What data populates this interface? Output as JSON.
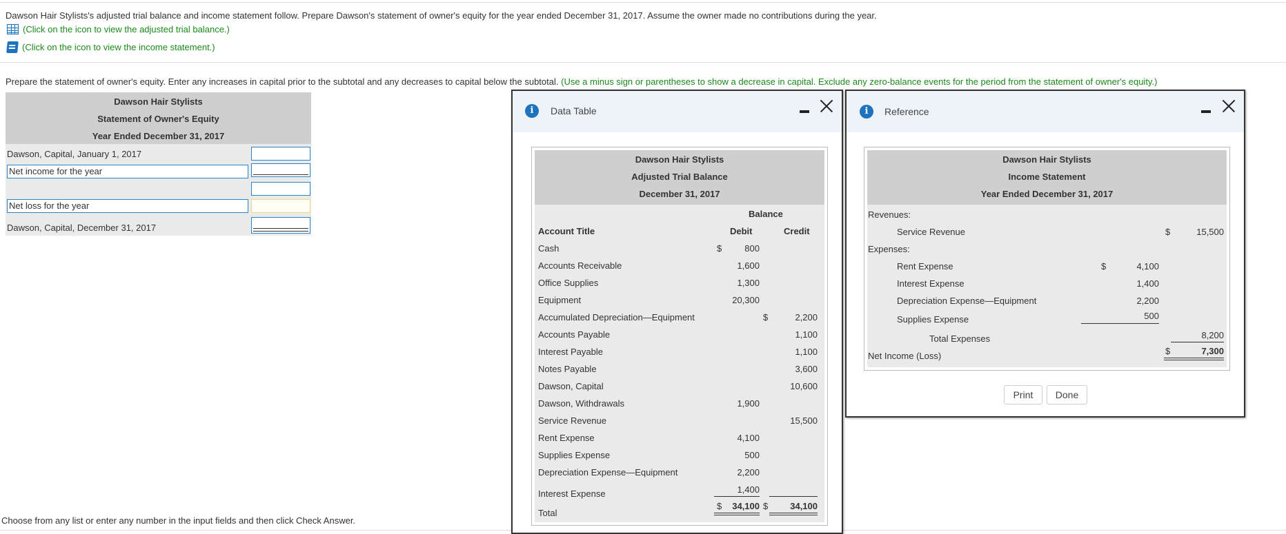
{
  "problem": {
    "prompt": "Dawson Hair Stylists's adjusted trial balance and income statement follow. Prepare Dawson's statement of owner's equity for the year ended December 31, 2017. Assume the owner made no contributions during the year.",
    "link1": "(Click on the icon to view the adjusted trial balance.)",
    "link2": "(Click on the icon to view the income statement.)",
    "instruction": "Prepare the statement of owner's equity. Enter any increases in capital prior to the subtotal and any decreases to capital below the subtotal.",
    "instruction_hint": "(Use a minus sign or parentheses to show a decrease in capital. Exclude any zero-balance events for the period from the statement of owner's equity.)",
    "footer": "Choose from any list or enter any number in the input fields and then click Check Answer."
  },
  "worksheet": {
    "title1": "Dawson Hair Stylists",
    "title2": "Statement of Owner's Equity",
    "title3": "Year Ended December 31, 2017",
    "row1_label": "Dawson, Capital, January 1, 2017",
    "row2_value": "Net income for the year",
    "row4_value": "Net loss for the year",
    "row5_label": "Dawson, Capital, December 31, 2017"
  },
  "data_table_dialog": {
    "title": "Data Table",
    "header1": "Dawson Hair Stylists",
    "header2": "Adjusted Trial Balance",
    "header3": "December 31, 2017",
    "balance_label": "Balance",
    "col_account": "Account Title",
    "col_debit": "Debit",
    "col_credit": "Credit",
    "rows": [
      {
        "account": "Cash",
        "debit_sign": "$",
        "debit": "800",
        "credit_sign": "",
        "credit": ""
      },
      {
        "account": "Accounts Receivable",
        "debit_sign": "",
        "debit": "1,600",
        "credit_sign": "",
        "credit": ""
      },
      {
        "account": "Office Supplies",
        "debit_sign": "",
        "debit": "1,300",
        "credit_sign": "",
        "credit": ""
      },
      {
        "account": "Equipment",
        "debit_sign": "",
        "debit": "20,300",
        "credit_sign": "",
        "credit": ""
      },
      {
        "account": "Accumulated Depreciation—Equipment",
        "debit_sign": "",
        "debit": "",
        "credit_sign": "$",
        "credit": "2,200"
      },
      {
        "account": "Accounts Payable",
        "debit_sign": "",
        "debit": "",
        "credit_sign": "",
        "credit": "1,100"
      },
      {
        "account": "Interest Payable",
        "debit_sign": "",
        "debit": "",
        "credit_sign": "",
        "credit": "1,100"
      },
      {
        "account": "Notes Payable",
        "debit_sign": "",
        "debit": "",
        "credit_sign": "",
        "credit": "3,600"
      },
      {
        "account": "Dawson, Capital",
        "debit_sign": "",
        "debit": "",
        "credit_sign": "",
        "credit": "10,600"
      },
      {
        "account": "Dawson, Withdrawals",
        "debit_sign": "",
        "debit": "1,900",
        "credit_sign": "",
        "credit": ""
      },
      {
        "account": "Service Revenue",
        "debit_sign": "",
        "debit": "",
        "credit_sign": "",
        "credit": "15,500"
      },
      {
        "account": "Rent Expense",
        "debit_sign": "",
        "debit": "4,100",
        "credit_sign": "",
        "credit": ""
      },
      {
        "account": "Supplies Expense",
        "debit_sign": "",
        "debit": "500",
        "credit_sign": "",
        "credit": ""
      },
      {
        "account": "Depreciation Expense—Equipment",
        "debit_sign": "",
        "debit": "2,200",
        "credit_sign": "",
        "credit": ""
      },
      {
        "account": "Interest Expense",
        "debit_sign": "",
        "debit": "1,400",
        "credit_sign": "",
        "credit": ""
      }
    ],
    "total_label": "Total",
    "total_debit_sign": "$",
    "total_debit": "34,100",
    "total_credit_sign": "$",
    "total_credit": "34,100"
  },
  "reference_dialog": {
    "title": "Reference",
    "header1": "Dawson Hair Stylists",
    "header2": "Income Statement",
    "header3": "Year Ended December 31, 2017",
    "revenues_label": "Revenues:",
    "service_revenue_label": "Service Revenue",
    "service_revenue_sign": "$",
    "service_revenue_value": "15,500",
    "expenses_label": "Expenses:",
    "rent_label": "Rent Expense",
    "rent_sign": "$",
    "rent_value": "4,100",
    "interest_label": "Interest Expense",
    "interest_value": "1,400",
    "depreciation_label": "Depreciation Expense—Equipment",
    "depreciation_value": "2,200",
    "supplies_label": "Supplies Expense",
    "supplies_value": "500",
    "total_expenses_label": "Total Expenses",
    "total_expenses_value": "8,200",
    "net_income_label": "Net Income (Loss)",
    "net_income_sign": "$",
    "net_income_value": "7,300",
    "print_button": "Print",
    "done_button": "Done"
  }
}
